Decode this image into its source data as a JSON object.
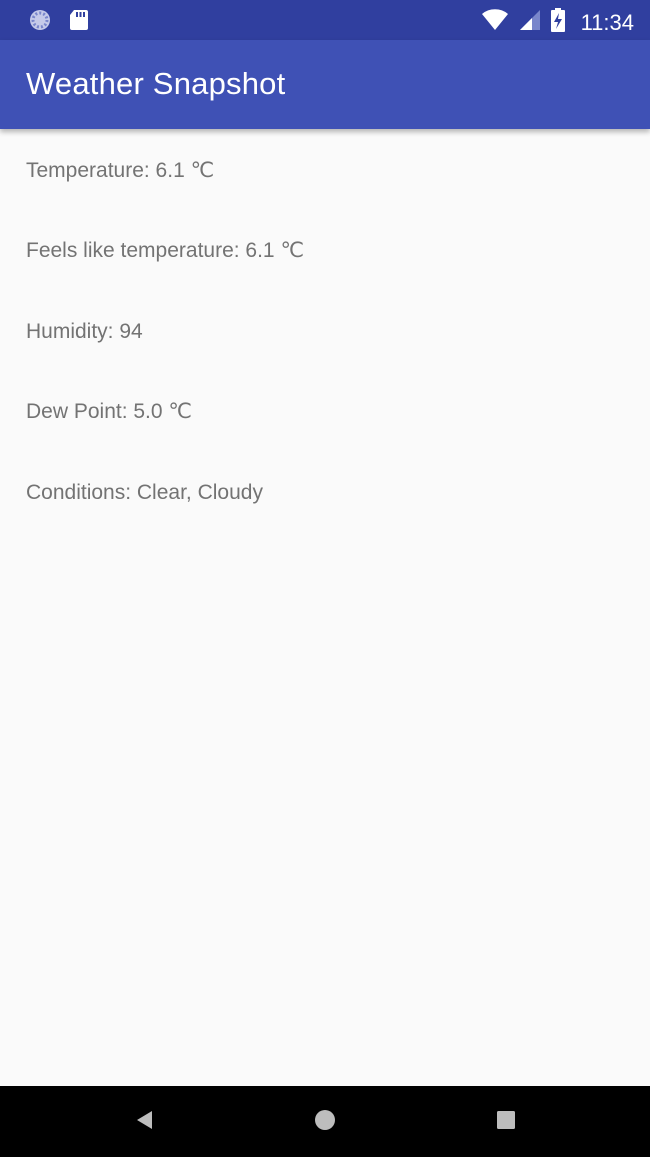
{
  "status_bar": {
    "time": "11:34",
    "icons": [
      "sync-icon",
      "sd-card-icon",
      "wifi-icon",
      "cell-signal-icon",
      "battery-charging-icon"
    ]
  },
  "app_bar": {
    "title": "Weather Snapshot",
    "background_color": "#3f51b5"
  },
  "weather": {
    "temperature": "Temperature: 6.1 ℃",
    "feels_like": "Feels like temperature: 6.1 ℃",
    "humidity": "Humidity: 94",
    "dew_point": "Dew Point: 5.0 ℃",
    "conditions": "Conditions: Clear, Cloudy"
  },
  "nav_bar": {
    "icons": [
      "back-icon",
      "home-icon",
      "recents-icon"
    ]
  }
}
